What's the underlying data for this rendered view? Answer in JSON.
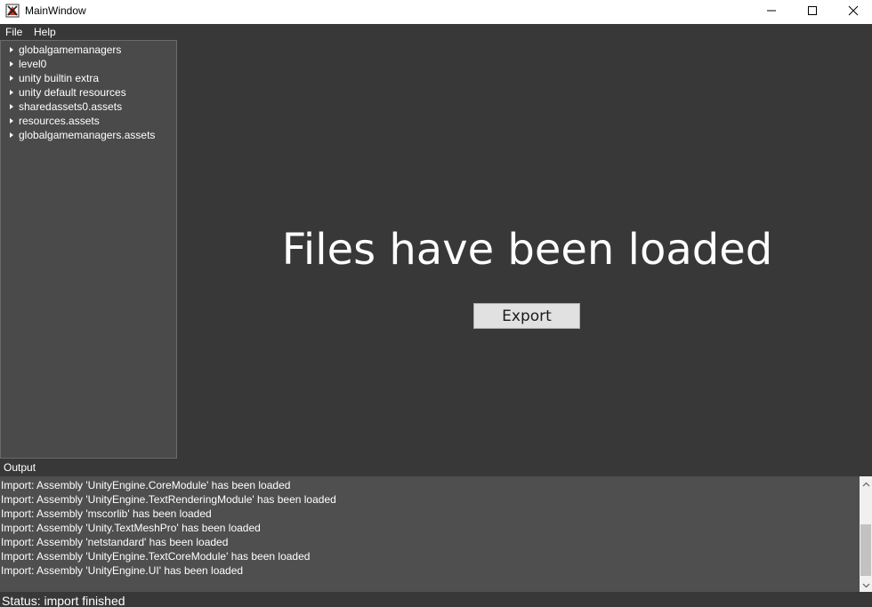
{
  "window": {
    "title": "MainWindow",
    "icon": "unity-asset-tool-icon"
  },
  "menu": {
    "items": [
      {
        "label": "File"
      },
      {
        "label": "Help"
      }
    ]
  },
  "tree": {
    "items": [
      {
        "label": "globalgamemanagers"
      },
      {
        "label": "level0"
      },
      {
        "label": "unity builtin extra"
      },
      {
        "label": "unity default resources"
      },
      {
        "label": "sharedassets0.assets"
      },
      {
        "label": "resources.assets"
      },
      {
        "label": "globalgamemanagers.assets"
      }
    ]
  },
  "main": {
    "headline": "Files have been loaded",
    "export_label": "Export"
  },
  "output": {
    "title": "Output",
    "lines": [
      "Import: Assembly 'UnityEngine.CoreModule' has been loaded",
      "Import: Assembly 'UnityEngine.TextRenderingModule' has been loaded",
      "Import: Assembly 'mscorlib' has been loaded",
      "Import: Assembly 'Unity.TextMeshPro' has been loaded",
      "Import: Assembly 'netstandard' has been loaded",
      "Import: Assembly 'UnityEngine.TextCoreModule' has been loaded",
      "Import: Assembly 'UnityEngine.UI' has been loaded"
    ]
  },
  "status": {
    "text": "Status: import finished"
  },
  "colors": {
    "background": "#383838",
    "tree_bg": "#4a4a4a",
    "output_bg": "#4f4f4f",
    "button_bg": "#e1e1e1"
  }
}
